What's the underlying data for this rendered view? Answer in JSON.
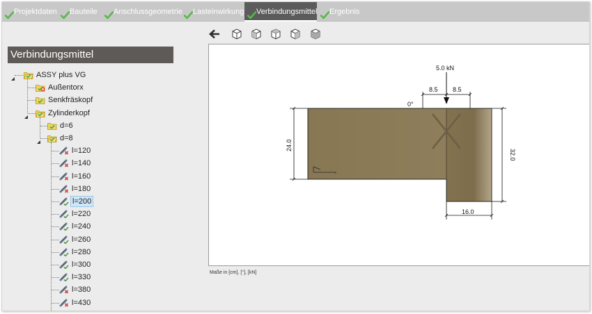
{
  "tabs": [
    {
      "label": "Projektdaten",
      "active": false
    },
    {
      "label": "Bauteile",
      "active": false
    },
    {
      "label": "Anschlussgeometrie",
      "active": false
    },
    {
      "label": "Lasteinwirkung",
      "active": false
    },
    {
      "label": "Verbindungsmittel",
      "active": true
    },
    {
      "label": "Ergebnis",
      "active": false
    }
  ],
  "tree": {
    "title": "Verbindungsmittel",
    "root": {
      "label": "ASSY plus VG",
      "icon": "folder-open-icon"
    },
    "heads": [
      {
        "label": "Außentorx",
        "icon": "folder-error-icon"
      },
      {
        "label": "Senkfräskopf",
        "icon": "folder-icon"
      },
      {
        "label": "Zylinderkopf",
        "icon": "folder-open-icon"
      }
    ],
    "diameters": [
      {
        "label": "d=6",
        "icon": "folder-icon"
      },
      {
        "label": "d=8",
        "icon": "folder-open-icon"
      }
    ],
    "lengths": [
      {
        "label": "l=120",
        "status": "invalid"
      },
      {
        "label": "l=140",
        "status": "invalid"
      },
      {
        "label": "l=160",
        "status": "invalid"
      },
      {
        "label": "l=180",
        "status": "invalid"
      },
      {
        "label": "l=200",
        "status": "valid",
        "selected": true
      },
      {
        "label": "l=220",
        "status": "valid"
      },
      {
        "label": "l=240",
        "status": "valid"
      },
      {
        "label": "l=260",
        "status": "valid"
      },
      {
        "label": "l=280",
        "status": "valid"
      },
      {
        "label": "l=300",
        "status": "valid"
      },
      {
        "label": "l=330",
        "status": "valid"
      },
      {
        "label": "l=380",
        "status": "invalid"
      },
      {
        "label": "l=430",
        "status": "invalid"
      }
    ]
  },
  "toolbar": {
    "tools": [
      "back-arrow-icon",
      "view-cube-icon",
      "view-cube-front-icon",
      "view-cube-top-icon",
      "view-cube-side-icon",
      "view-cube-iso-icon"
    ]
  },
  "drawing": {
    "load_label": "5.0 kN",
    "spacing_left": "8.5",
    "spacing_right": "8.5",
    "angle_label": "0°",
    "height_left": "24.0",
    "height_right": "32.0",
    "width_bottom": "16.0",
    "colors": {
      "wood": "#8a7a57",
      "wood_dark": "#6f6245",
      "line": "#1a1a1a"
    }
  },
  "units_note": "Maße in [cm], [°], [kN]",
  "colors": {
    "tabbar": "#c8c8c8",
    "tab_active": "#5b5b5b",
    "check": "#4caf50",
    "title_bar": "#5e5a58"
  }
}
